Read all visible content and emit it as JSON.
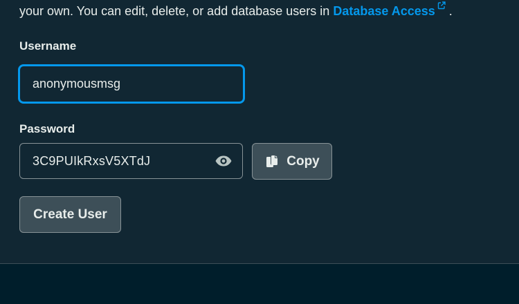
{
  "intro": {
    "text": "your own. You can edit, delete, or add database users in ",
    "link_label": "Database Access",
    "trailing": " ."
  },
  "username": {
    "label": "Username",
    "value": "anonymousmsg"
  },
  "password": {
    "label": "Password",
    "value": "3C9PUIkRxsV5XTdJ"
  },
  "buttons": {
    "copy_label": "Copy",
    "create_label": "Create User"
  },
  "icons": {
    "external_link": "external-link-icon",
    "eye": "eye-icon",
    "copy": "copy-icon"
  },
  "colors": {
    "panel_bg": "#112733",
    "page_bg": "#001e2b",
    "accent": "#0498ec",
    "button_bg": "#3d4f58",
    "border": "#889397",
    "text": "#e8edeb"
  }
}
